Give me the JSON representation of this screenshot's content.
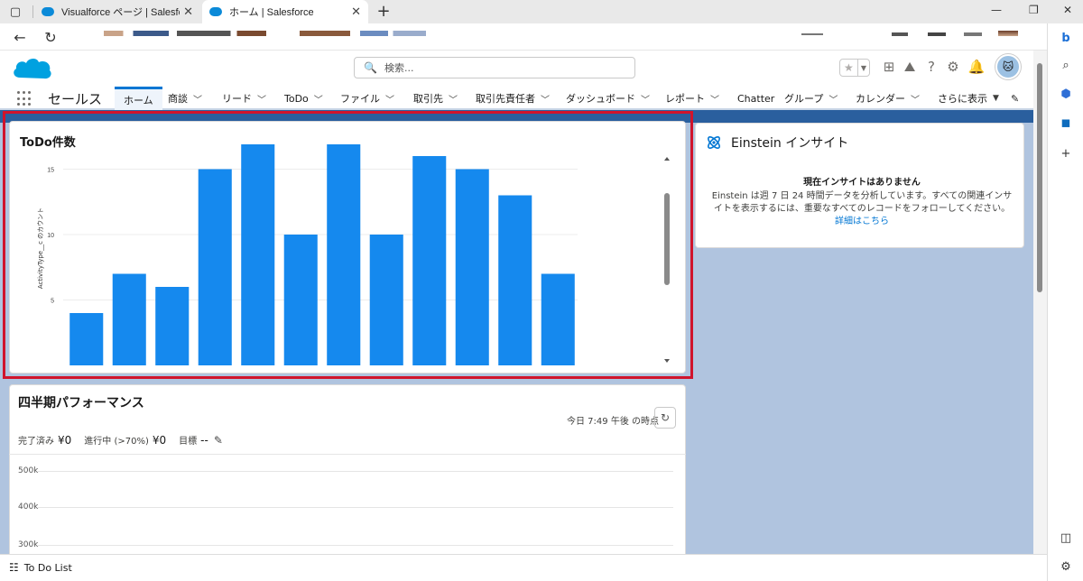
{
  "browser": {
    "tabs": [
      {
        "title": "Visualforce ページ | Salesforce",
        "active": false
      },
      {
        "title": "ホーム | Salesforce",
        "active": true
      }
    ],
    "new_tab": "+",
    "close_glyph": "✕",
    "icons": {
      "back": "arrow-left-icon",
      "reload": "reload-icon",
      "minimize": "minimize-icon",
      "maximize": "maximize-icon",
      "close": "close-icon"
    }
  },
  "sf_header": {
    "search_placeholder": "検索...",
    "search_glyph": "🔍"
  },
  "navbar": {
    "app_name": "セールス",
    "items": [
      {
        "label": "ホーム",
        "active": true,
        "has_menu": false
      },
      {
        "label": "商談",
        "has_menu": true
      },
      {
        "label": "リード",
        "has_menu": true
      },
      {
        "label": "ToDo",
        "has_menu": true
      },
      {
        "label": "ファイル",
        "has_menu": true
      },
      {
        "label": "取引先",
        "has_menu": true
      },
      {
        "label": "取引先責任者",
        "has_menu": true
      },
      {
        "label": "ダッシュボード",
        "has_menu": true
      },
      {
        "label": "レポート",
        "has_menu": true
      },
      {
        "label": "Chatter",
        "has_menu": false
      },
      {
        "label": "グループ",
        "has_menu": true
      },
      {
        "label": "カレンダー",
        "has_menu": true
      },
      {
        "label": "さらに表示",
        "has_menu": true
      }
    ]
  },
  "todo_card": {
    "title": "ToDo件数"
  },
  "chart_data": {
    "type": "bar",
    "title": "ToDo件数",
    "xlabel": "",
    "ylabel": "ActivityType__c のカウント",
    "y_ticks": [
      5,
      10,
      15
    ],
    "ylim": [
      0,
      17.5
    ],
    "values": [
      4,
      7,
      6,
      15,
      17,
      10,
      17,
      10,
      16,
      15,
      13,
      7
    ],
    "color": "#1589ee",
    "grid": true
  },
  "einstein": {
    "title": "Einstein インサイト",
    "heading": "現在インサイトはありません",
    "body": "Einstein は週 7 日 24 時間データを分析しています。すべての関連インサイトを表示するには、重要なすべてのレコードをフォローしてください。",
    "link": "詳細はこちら"
  },
  "quarterly": {
    "title": "四半期パフォーマンス",
    "timestamp": "今日 7:49 午後 の時点",
    "completed_label": "完了済み",
    "completed_value": "¥0",
    "in_progress_label": "進行中 (>70%)",
    "in_progress_value": "¥0",
    "goal_label": "目標",
    "goal_value": "--",
    "y_ticks": [
      "500k",
      "400k",
      "300k"
    ]
  },
  "utility_bar": {
    "todo_list": "To Do List"
  },
  "colors": {
    "brand_blue": "#0176d3",
    "bar_blue": "#1589ee",
    "highlight_red": "#d0142c",
    "content_bg": "#b0c4df"
  }
}
